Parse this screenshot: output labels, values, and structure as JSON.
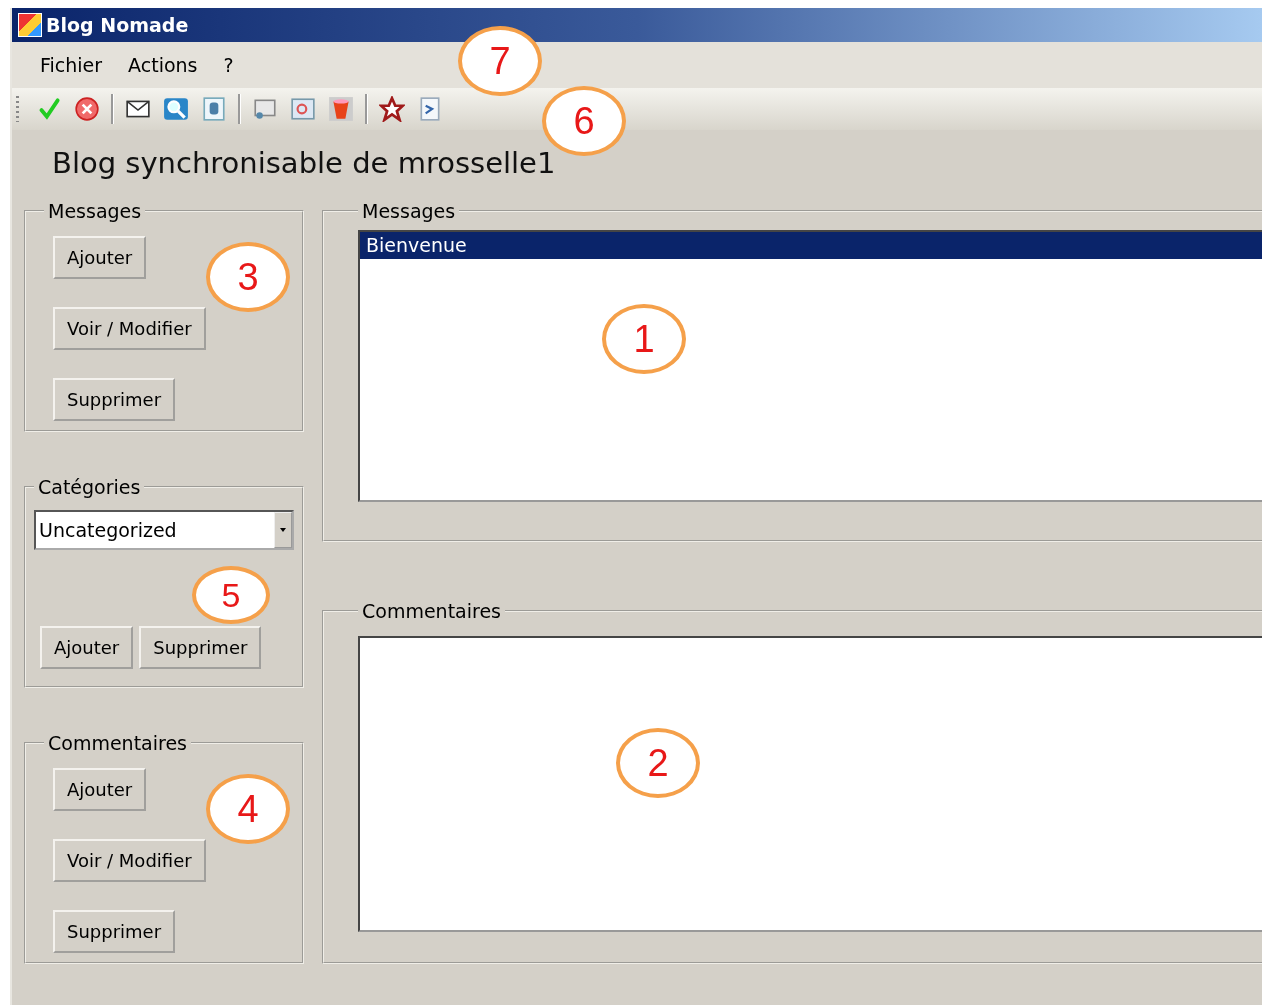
{
  "window": {
    "title": "Blog Nomade"
  },
  "menu": {
    "items": [
      "Fichier",
      "Actions",
      "?"
    ],
    "callout": "7"
  },
  "toolbar": {
    "callout": "6",
    "items": [
      {
        "kind": "check"
      },
      {
        "kind": "error"
      },
      {
        "kind": "separator"
      },
      {
        "kind": "mail"
      },
      {
        "kind": "search"
      },
      {
        "kind": "database"
      },
      {
        "kind": "separator"
      },
      {
        "kind": "screen"
      },
      {
        "kind": "picture"
      },
      {
        "kind": "cup"
      },
      {
        "kind": "separator"
      },
      {
        "kind": "star"
      },
      {
        "kind": "document"
      }
    ]
  },
  "heading": "Blog synchronisable de mrosselle1",
  "left_groups": [
    {
      "title": "Messages",
      "kind": "stack",
      "callout": "3",
      "buttons": [
        "Ajouter",
        "Voir / Modifier",
        "Supprimer"
      ]
    },
    {
      "title": "Catégories",
      "kind": "combo",
      "callout": "5",
      "value": "Uncategorized",
      "buttons": [
        "Ajouter",
        "Supprimer"
      ]
    },
    {
      "title": "Commentaires",
      "kind": "stack",
      "callout": "4",
      "buttons": [
        "Ajouter",
        "Voir / Modifier",
        "Supprimer"
      ]
    }
  ],
  "right_groups": [
    {
      "title": "Messages",
      "callout": "1",
      "items": [
        {
          "text": "Bienvenue",
          "selected": true
        }
      ]
    },
    {
      "title": "Commentaires",
      "callout": "2"
    }
  ]
}
